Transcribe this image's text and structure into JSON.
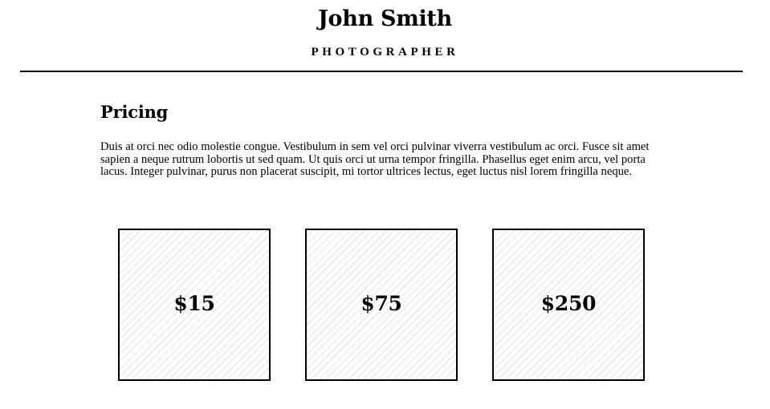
{
  "header": {
    "name": "John Smith",
    "role": "PHOTOGRAPHER"
  },
  "main": {
    "title": "Pricing",
    "intro": "Duis at orci nec odio molestie congue. Vestibulum in sem vel orci pulvinar viverra vestibulum ac orci. Fusce sit amet sapien a neque rutrum lobortis ut sed quam. Ut quis orci ut urna tempor fringilla. Phasellus eget enim arcu, vel porta lacus. Integer pulvinar, purus non placerat suscipit, mi tortor ultrices lectus, eget luctus nisl lorem fringilla neque.",
    "plans": [
      {
        "price": "$15"
      },
      {
        "price": "$75"
      },
      {
        "price": "$250"
      }
    ]
  },
  "colors": {
    "text": "#000000",
    "background": "#ffffff",
    "card_stripe": "#ececec"
  }
}
